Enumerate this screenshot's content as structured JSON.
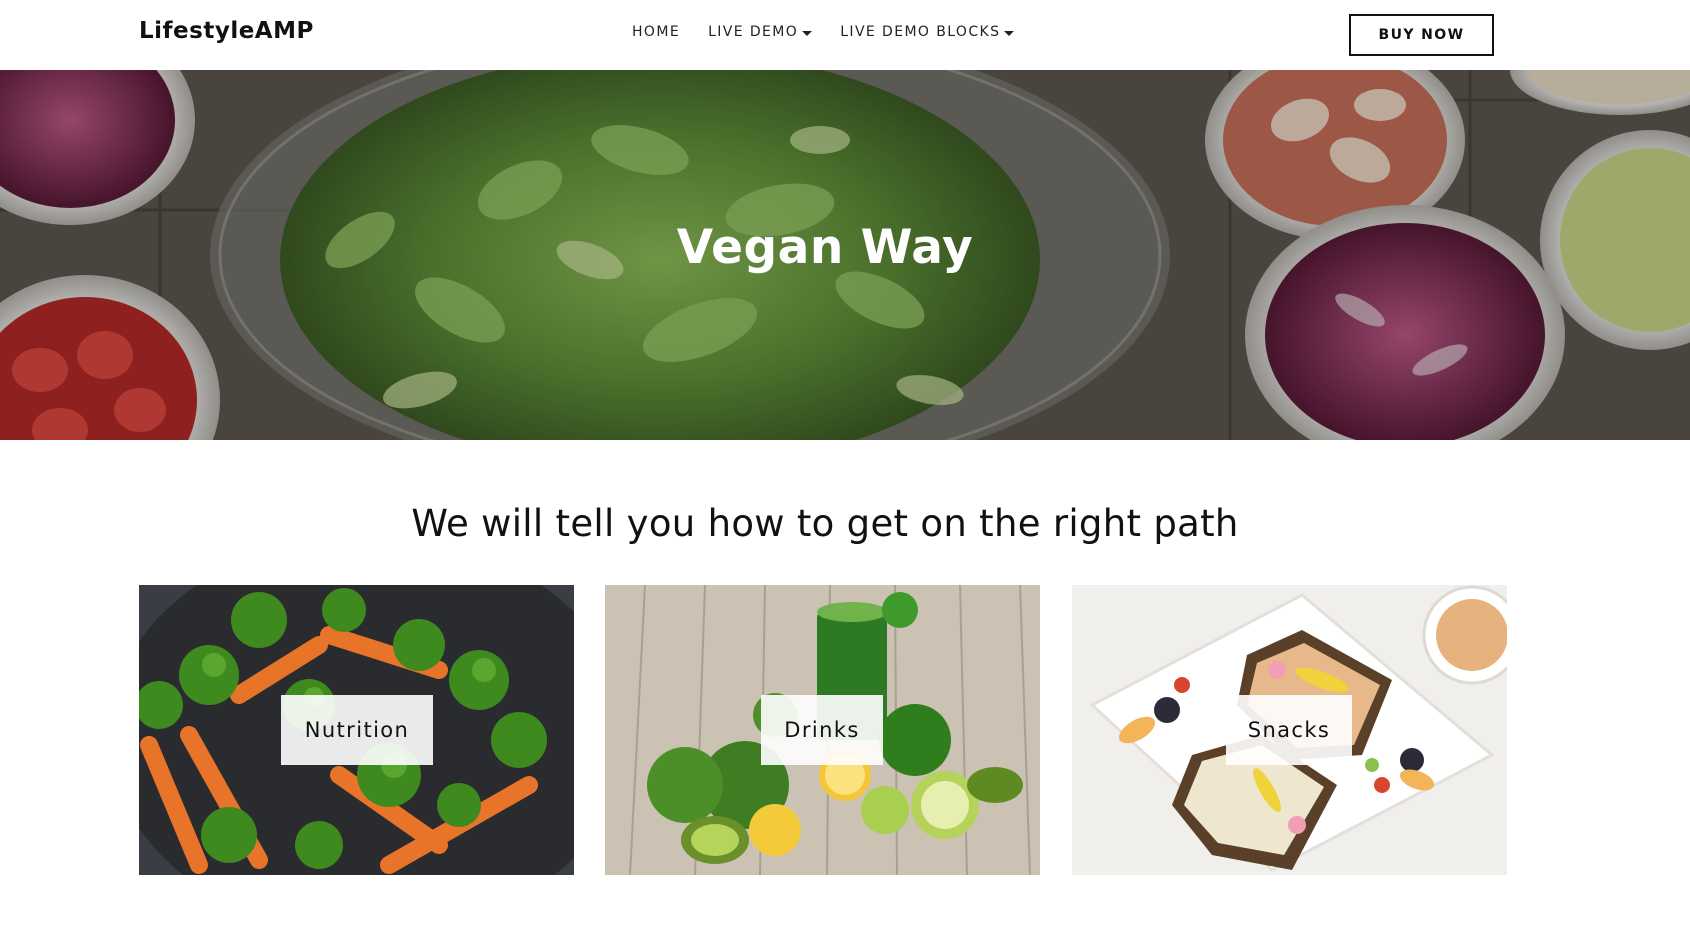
{
  "header": {
    "logo": "LifestyleAMP",
    "nav": [
      {
        "label": "HOME",
        "dropdown": false
      },
      {
        "label": "LIVE DEMO",
        "dropdown": true
      },
      {
        "label": "LIVE DEMO BLOCKS",
        "dropdown": true
      }
    ],
    "buy_label": "BUY NOW"
  },
  "hero": {
    "title": "Vegan Way"
  },
  "section": {
    "headline": "We will tell you how to get on the right path"
  },
  "cards": [
    {
      "label": "Nutrition"
    },
    {
      "label": "Drinks"
    },
    {
      "label": "Snacks"
    }
  ]
}
